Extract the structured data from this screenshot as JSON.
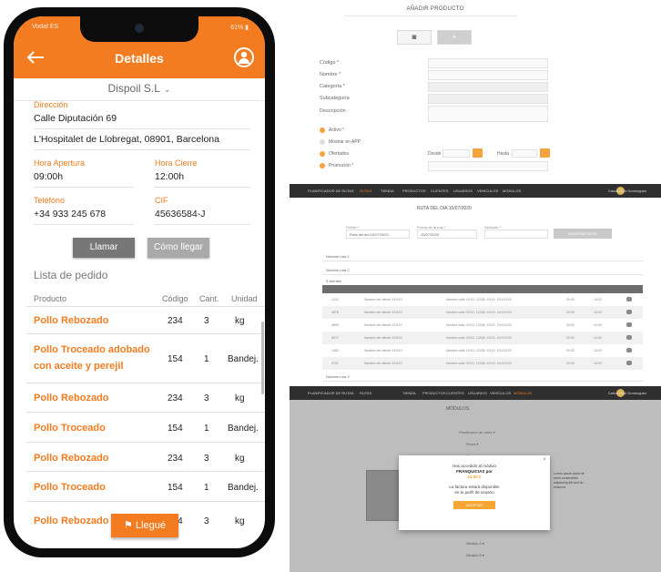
{
  "phone": {
    "status_left": "Vodaf ES",
    "status_right": "61% ▮",
    "title": "Detalles",
    "company": "Dispoil S.L",
    "direccion_label": "Dirección",
    "direccion_1": "Calle Diputación 69",
    "direccion_2": "L'Hospitalet de Llobregat, 08901, Barcelona",
    "apertura_label": "Hora Apertura",
    "apertura": "09:00h",
    "cierre_label": "Hora Cierre",
    "cierre": "12:00h",
    "telefono_label": "Teléfono",
    "telefono": "+34 933 245 678",
    "cif_label": "CIF",
    "cif": "45636584-J",
    "llamar": "Llamar",
    "como_llegar": "Cómo llegar",
    "lista_title": "Lista de pedido",
    "col_producto": "Producto",
    "col_codigo": "Código",
    "col_cant": "Cant.",
    "col_unidad": "Unidad",
    "rows": [
      {
        "producto": "Pollo Rebozado",
        "codigo": "234",
        "cant": "3",
        "unidad": "kg"
      },
      {
        "producto": "Pollo Troceado adobado con aceite y perejil",
        "codigo": "154",
        "cant": "1",
        "unidad": "Bandej."
      },
      {
        "producto": "Pollo Rebozado",
        "codigo": "234",
        "cant": "3",
        "unidad": "kg"
      },
      {
        "producto": "Pollo Troceado",
        "codigo": "154",
        "cant": "1",
        "unidad": "Bandej."
      },
      {
        "producto": "Pollo Rebozado",
        "codigo": "234",
        "cant": "3",
        "unidad": "kg"
      },
      {
        "producto": "Pollo Troceado",
        "codigo": "154",
        "cant": "1",
        "unidad": "Bandej."
      },
      {
        "producto": "Pollo Rebozado",
        "codigo": "234",
        "cant": "3",
        "unidad": "kg"
      }
    ],
    "llegue": "Llegué",
    "accent": "#f47c20"
  },
  "add_product": {
    "title": "AÑADIR PRODUCTO",
    "labels": [
      "Código *",
      "Nombre *",
      "Categoría *",
      "Subcategoría",
      "Descripción"
    ],
    "checks": [
      "Activo *",
      "Mostrar en APP",
      "Ofertados",
      "Promoción *"
    ],
    "desde": "Desde",
    "hasta": "Hasta"
  },
  "route": {
    "nav": [
      "PLANIFICADOR DE RUTAS",
      "RUTAS",
      "TIENDA",
      "PRODUCTOS",
      "CLIENTES",
      "USUARIOS",
      "VEHÍCULOS",
      "MÓDULOS"
    ],
    "active_nav": "RUTAS",
    "user": "Carlos Ruiz Domínguez",
    "title": "RUTA DEL DIA 15/07/2020",
    "fecha_label": "Fecha *",
    "fecha_value": "Ruta del día 15/07/2020",
    "fecha_ruta_label": "Fecha de la ruta *",
    "fecha_ruta_value": "15/07/2020",
    "vehiculo_label": "Vehículo *",
    "guardar": "GUARDAR RUTA",
    "zona1": "Nombre ruta 1",
    "zona2": "Nombre ruta 2",
    "zona3": "Nombre ruta 3",
    "clientes": "3 clientes",
    "table_rows": [
      {
        "id": "1234",
        "cliente": "Nombre del cliente XXXXX",
        "dir": "Nombre calle XXXX, 12345, XXXX, XXXXXXX",
        "h1": "09:00",
        "h2": "14:00"
      },
      {
        "id": "4875",
        "cliente": "Nombre del cliente XXXXX",
        "dir": "Nombre calle XXXX, 12345, XXXX, XXXXXXX",
        "h1": "09:00",
        "h2": "14:00"
      },
      {
        "id": "4895",
        "cliente": "Nombre del cliente XXXXX",
        "dir": "Nombre calle XXXX, 12345, XXXX, XXXXXXX",
        "h1": "09:00",
        "h2": "14:00"
      },
      {
        "id": "6372",
        "cliente": "Nombre del cliente XXXXX",
        "dir": "Nombre calle XXXX, 12345, XXXX, XXXXXXX",
        "h1": "09:00",
        "h2": "14:00"
      },
      {
        "id": "1452",
        "cliente": "Nombre del cliente XXXXX",
        "dir": "Nombre calle XXXX, 12345, XXXX, XXXXXXX",
        "h1": "09:00",
        "h2": "14:00"
      },
      {
        "id": "3781",
        "cliente": "Nombre del cliente XXXXX",
        "dir": "Nombre calle XXXX, 12345, XXXX, XXXXXXX",
        "h1": "09:00",
        "h2": "14:00"
      }
    ]
  },
  "modules": {
    "title": "MÓDULOS",
    "m1": "Planificador de rutas ▾",
    "m2": "Rutas ▾",
    "m3": "Tienda ▾",
    "m_bottom1": "Módulo 4 ▾",
    "m_bottom2": "Módulo 5 ▾",
    "modal_l1": "Has accedido al módulo",
    "modal_l2": "FRANQUICIAS por",
    "modal_l3": "23,00 €",
    "modal_l4": "La factura estará disponible",
    "modal_l5": "en tu perfil de usuario",
    "modal_btn": "ACEPTAR",
    "thumb_text": "Lorem ipsum dolor sit amet consectetur adipiscing elit sed do eiusmod"
  }
}
